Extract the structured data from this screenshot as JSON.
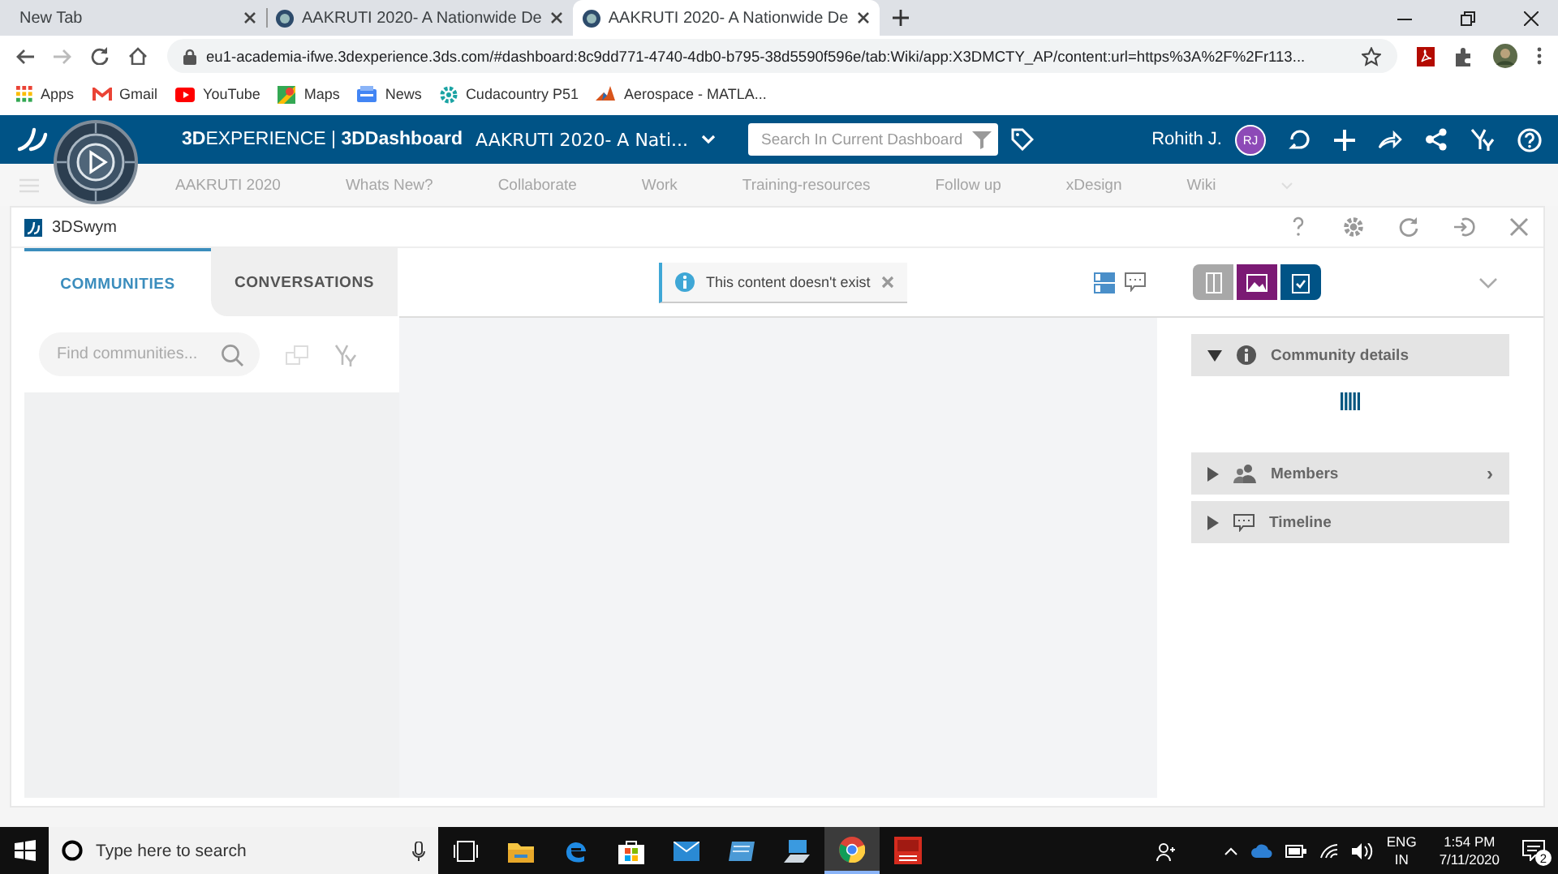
{
  "browser": {
    "tabs": [
      {
        "title": "New Tab",
        "icon": false,
        "selected": false
      },
      {
        "title": "AAKRUTI 2020- A Nationwide De",
        "icon": true,
        "selected": false
      },
      {
        "title": "AAKRUTI 2020- A Nationwide De",
        "icon": true,
        "selected": true
      }
    ],
    "url": "eu1-academia-ifwe.3dexperience.3ds.com/#dashboard:8c9dd771-4740-4db0-b795-38d5590f596e/tab:Wiki/app:X3DMCTY_AP/content:url=https%3A%2F%2Fr113...",
    "bookmarks": [
      {
        "label": "Apps",
        "kind": "apps"
      },
      {
        "label": "Gmail",
        "kind": "gmail"
      },
      {
        "label": "YouTube",
        "kind": "youtube"
      },
      {
        "label": "Maps",
        "kind": "maps"
      },
      {
        "label": "News",
        "kind": "news"
      },
      {
        "label": "Cudacountry P51",
        "kind": "gear"
      },
      {
        "label": "Aerospace - MATLA...",
        "kind": "matlab"
      }
    ]
  },
  "app_bar": {
    "brand": "**3D**EXPERIENCE | **3DDashboard**",
    "dashboard_title": "AAKRUTI 2020- A Nati...",
    "search": {
      "placeholder": "Search In Current Dashboard"
    },
    "user": "Rohith J.",
    "avatar": "RJ"
  },
  "dashboard_tabs": [
    "AAKRUTI 2020",
    "Whats New?",
    "Collaborate",
    "Work",
    "Training-resources",
    "Follow up",
    "xDesign",
    "Wiki"
  ],
  "widget": {
    "title": "3DSwym",
    "left_tabs": [
      {
        "label": "COMMUNITIES",
        "selected": true
      },
      {
        "label": "CONVERSATIONS",
        "selected": false
      }
    ],
    "search": {
      "placeholder": "Find communities..."
    },
    "notice": "This content doesn't exist",
    "view_buttons": [
      {
        "color": "#a8a8a8"
      },
      {
        "color": "#7b1a74"
      },
      {
        "color": "#005386"
      }
    ],
    "sections": [
      {
        "label": "Community details",
        "kind": "info",
        "expanded": true
      },
      {
        "label": "Members",
        "kind": "members",
        "expanded": false,
        "arrow": "›"
      },
      {
        "label": "Timeline",
        "kind": "timeline",
        "expanded": false
      }
    ]
  },
  "taskbar": {
    "search": {
      "placeholder": "Type here to search"
    },
    "apps": [
      {
        "kind": "task-view",
        "selected": false
      },
      {
        "kind": "explorer",
        "selected": false
      },
      {
        "kind": "edge",
        "selected": false
      },
      {
        "kind": "store",
        "selected": false
      },
      {
        "kind": "mail",
        "selected": false
      },
      {
        "kind": "app",
        "selected": false
      },
      {
        "kind": "app2",
        "selected": false
      },
      {
        "kind": "chrome",
        "selected": true
      },
      {
        "kind": "solidworks",
        "selected": false
      }
    ],
    "language": "ENG",
    "region": "IN",
    "time": "1:54 PM",
    "date": "7/11/2020",
    "notifications": "2"
  }
}
